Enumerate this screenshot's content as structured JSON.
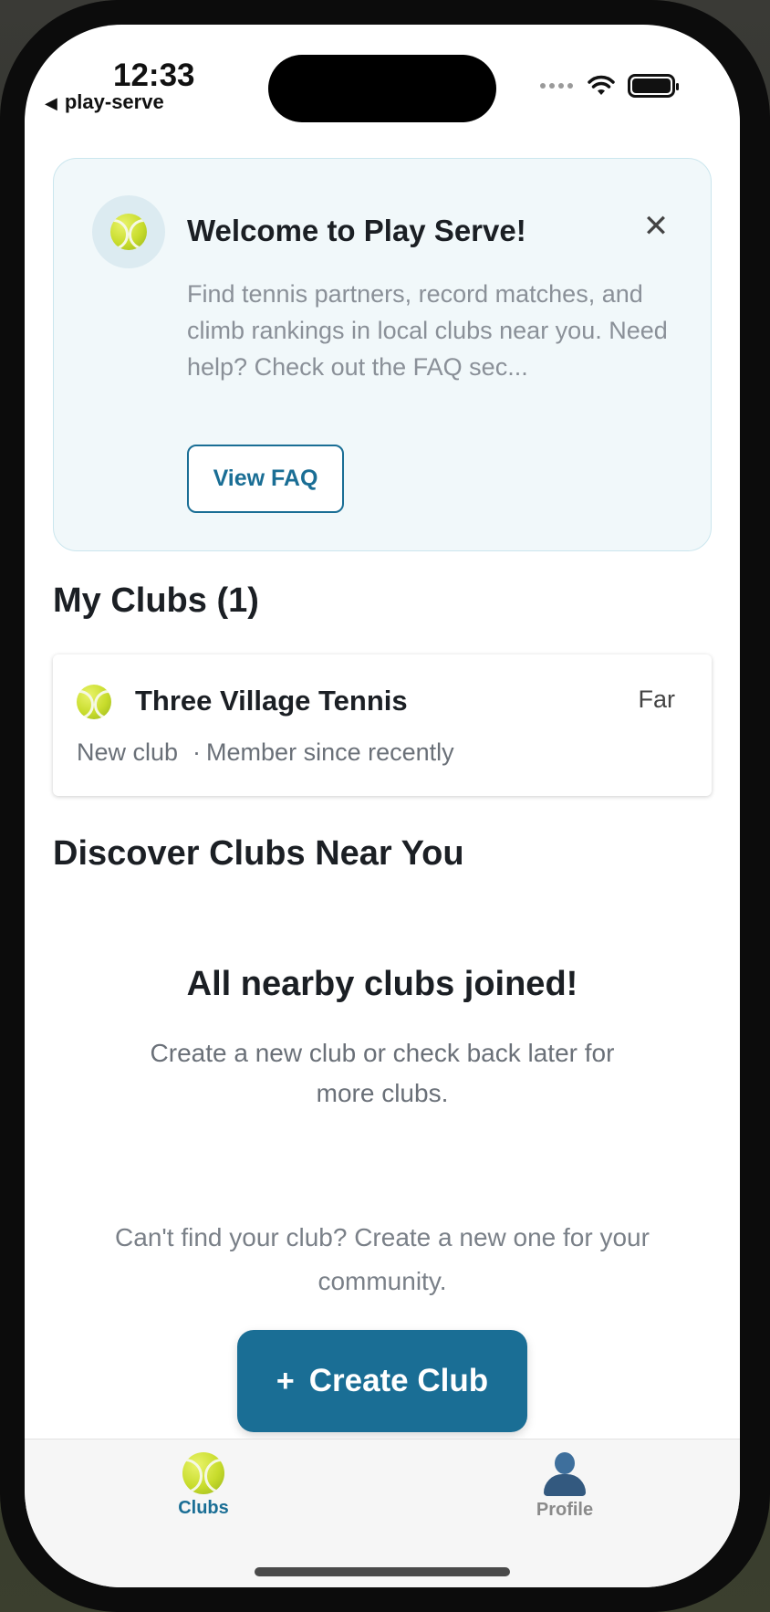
{
  "status_bar": {
    "time": "12:33",
    "back_app": "play-serve"
  },
  "welcome": {
    "title": "Welcome to Play Serve!",
    "close_glyph": "✕",
    "text": "Find tennis partners, record matches, and climb rankings in local clubs near you. Need help? Check out the FAQ sec...",
    "faq_button": "View FAQ"
  },
  "my_clubs": {
    "title": "My Clubs (1)",
    "clubs": [
      {
        "name": "Three Village Tennis",
        "distance": "Far",
        "status": "New club",
        "member_since": "Member since recently"
      }
    ]
  },
  "discover": {
    "title": "Discover Clubs Near You",
    "empty_title": "All nearby clubs joined!",
    "empty_text": "Create a new club or check back later for more clubs.",
    "cant_find": "Can't find your club? Create a new one for your community.",
    "create_button": "Create Club",
    "create_plus": "+"
  },
  "tabbar": {
    "tabs": [
      {
        "label": "Clubs",
        "icon": "tennis-ball-icon",
        "active": true
      },
      {
        "label": "Profile",
        "icon": "profile-icon",
        "active": false
      }
    ]
  },
  "colors": {
    "accent": "#1a6e95",
    "welcome_bg": "#f1f8fa"
  }
}
